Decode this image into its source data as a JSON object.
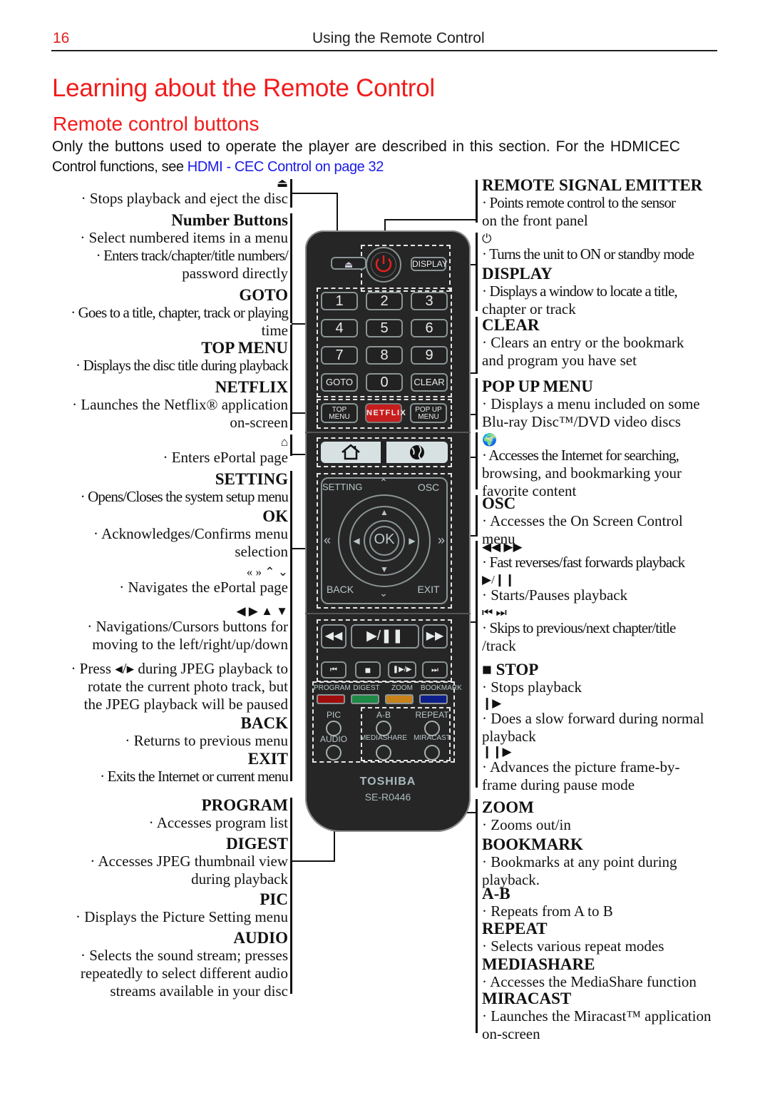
{
  "header": {
    "page_number": "16",
    "running_head": "Using the Remote Control"
  },
  "title": "Learning about the Remote Control",
  "subtitle": "Remote control buttons",
  "intro": {
    "line1": "Only the buttons used to operate the player are described in this section. For the HDMI­CEC",
    "line2_prefix": "Control functions, see ",
    "link_text": "HDMI ‐ CEC Control",
    "link_suffix": " on page 32"
  },
  "left_descriptions": [
    {
      "icon": "⏏",
      "icon_name": "eject-icon",
      "lines": [
        "· Stops playback and eject the disc"
      ]
    },
    {
      "heading": "Number Buttons",
      "lines": [
        "· Select numbered items in a menu",
        "·  Enters track/chapter/title numbers/",
        "password directly"
      ]
    },
    {
      "heading": "GOTO",
      "lines": [
        "·  Goes to a title, chapter, track or playing",
        "time"
      ]
    },
    {
      "heading": "TOP MENU",
      "lines": [
        "·  Displays the disc title during playback"
      ]
    },
    {
      "heading": "NETFLIX",
      "lines": [
        "·  Launches the Netflix® application",
        "on-screen"
      ]
    },
    {
      "icon": "⌂",
      "icon_name": "home-icon",
      "lines": [
        "· Enters ePortal page"
      ]
    },
    {
      "heading": "SETTING",
      "lines": [
        "·  Opens/Closes the system setup menu"
      ]
    },
    {
      "heading": "OK",
      "lines": [
        "·  Acknowledges/Confirms menu",
        "selection"
      ]
    },
    {
      "icon": "« » ⌃ ⌄",
      "icon_name": "eportal-nav-icons",
      "lines": [
        "· Navigates the ePortal page"
      ]
    },
    {
      "icon": "◀ ▶ ▲ ▼",
      "icon_name": "cursor-arrows-icons",
      "lines": [
        "·  Navigations/Cursors buttons for",
        "moving to the left/right/up/down"
      ]
    },
    {
      "lines": [
        "·  Press ◂/▸ during JPEG playback to",
        "rotate the current photo track, but",
        "the JPEG playback will be paused"
      ]
    },
    {
      "heading": "BACK",
      "lines": [
        "· Returns to previous menu"
      ]
    },
    {
      "heading": "EXIT",
      "lines": [
        "·  Exits the Internet or current menu"
      ]
    },
    {
      "heading": "PROGRAM",
      "lines": [
        "· Accesses program list"
      ]
    },
    {
      "heading": "DIGEST",
      "lines": [
        "·  Accesses JPEG thumbnail view",
        "during playback"
      ]
    },
    {
      "heading": "PIC",
      "lines": [
        "·  Displays the Picture Setting menu"
      ]
    },
    {
      "heading": "AUDIO",
      "lines": [
        "·  Selects the sound stream; presses",
        "repeatedly to select different audio",
        "streams available in your disc"
      ]
    }
  ],
  "right_descriptions": [
    {
      "heading": "REMOTE SIGNAL EMITTER",
      "lines": [
        "·  Points remote control to the sensor",
        "on the front panel"
      ]
    },
    {
      "icon": "⏻",
      "icon_name": "power-icon",
      "lines": [
        "· Turns the unit to ON or standby mode"
      ]
    },
    {
      "heading": "DISPLAY",
      "lines": [
        "· Displays a window to locate a title,",
        "chapter or track"
      ]
    },
    {
      "heading": "CLEAR",
      "lines": [
        "· Clears an entry or the bookmark",
        "and program you have set"
      ]
    },
    {
      "heading": "POP UP MENU",
      "lines": [
        "· Displays a menu included on some",
        "Blu-ray Disc™/DVD video discs"
      ]
    },
    {
      "icon": "🌍",
      "icon_name": "globe-icon",
      "lines": [
        "· Accesses the Internet for searching,",
        "browsing, and bookmarking your",
        "favorite content"
      ]
    },
    {
      "heading": "OSC",
      "lines": [
        "· Accesses the On Screen Control",
        "menu"
      ]
    },
    {
      "icon": "◀◀     ▶▶",
      "icon_name": "rewind-fastforward-icons",
      "lines": [
        "·  Fast reverses/fast forwards playback"
      ]
    },
    {
      "icon": "▶/❙❙",
      "icon_name": "play-pause-icon",
      "lines": [
        "· Starts/Pauses playback"
      ]
    },
    {
      "icon": "⏮    ⏭",
      "icon_name": "skip-icons",
      "lines": [
        "· Skips to previous/next chapter/title",
        "/track"
      ]
    },
    {
      "heading": "■ STOP",
      "lines": [
        "· Stops playback"
      ]
    },
    {
      "icon": "❙▶",
      "icon_name": "slow-forward-icon",
      "lines": [
        "· Does a slow forward during normal",
        "playback"
      ]
    },
    {
      "icon": "❙❙▶",
      "icon_name": "frame-advance-icon",
      "lines": [
        "· Advances the picture frame-by-",
        "frame during pause mode"
      ]
    },
    {
      "heading": "ZOOM",
      "lines": [
        "· Zooms out/in"
      ]
    },
    {
      "heading": "BOOKMARK",
      "lines": [
        "· Bookmarks at any point during",
        "playback."
      ]
    },
    {
      "heading": "A-B",
      "lines": [
        "· Repeats from A to B"
      ]
    },
    {
      "heading": "REPEAT",
      "lines": [
        "· Selects various repeat modes"
      ]
    },
    {
      "heading": "MEDIASHARE",
      "lines": [
        "· Accesses the MediaShare function"
      ]
    },
    {
      "heading": "MIRACAST",
      "lines": [
        "· Launches the Miracast™ application",
        "on-screen"
      ]
    }
  ],
  "remote": {
    "brand": "TOSHIBA",
    "model": "SE-R0446",
    "display_label": "DISPLAY",
    "numbers": [
      "1",
      "2",
      "3",
      "4",
      "5",
      "6",
      "7",
      "8",
      "9"
    ],
    "goto": "GOTO",
    "zero": "0",
    "clear": "CLEAR",
    "top_menu": [
      "TOP",
      "MENU"
    ],
    "netflix": "NETFLIX",
    "popup_menu": [
      "POP UP",
      "MENU"
    ],
    "setting": "SETTING",
    "osc": "OSC",
    "ok": "OK",
    "back": "BACK",
    "exit": "EXIT",
    "color_labels": [
      "PROGRAM",
      "DIGEST",
      "ZOOM",
      "BOOKMARK"
    ],
    "color_keys": [
      "#a00d0d",
      "#1e8a45",
      "#c8821a",
      "#0e1f8c"
    ],
    "round_buttons": [
      "PIC",
      "A-B",
      "REPEAT",
      "AUDIO",
      "MEDIASHARE",
      "MIRACAST"
    ],
    "netflix_color": "#c81d1d",
    "power_color": "#e3201f"
  }
}
